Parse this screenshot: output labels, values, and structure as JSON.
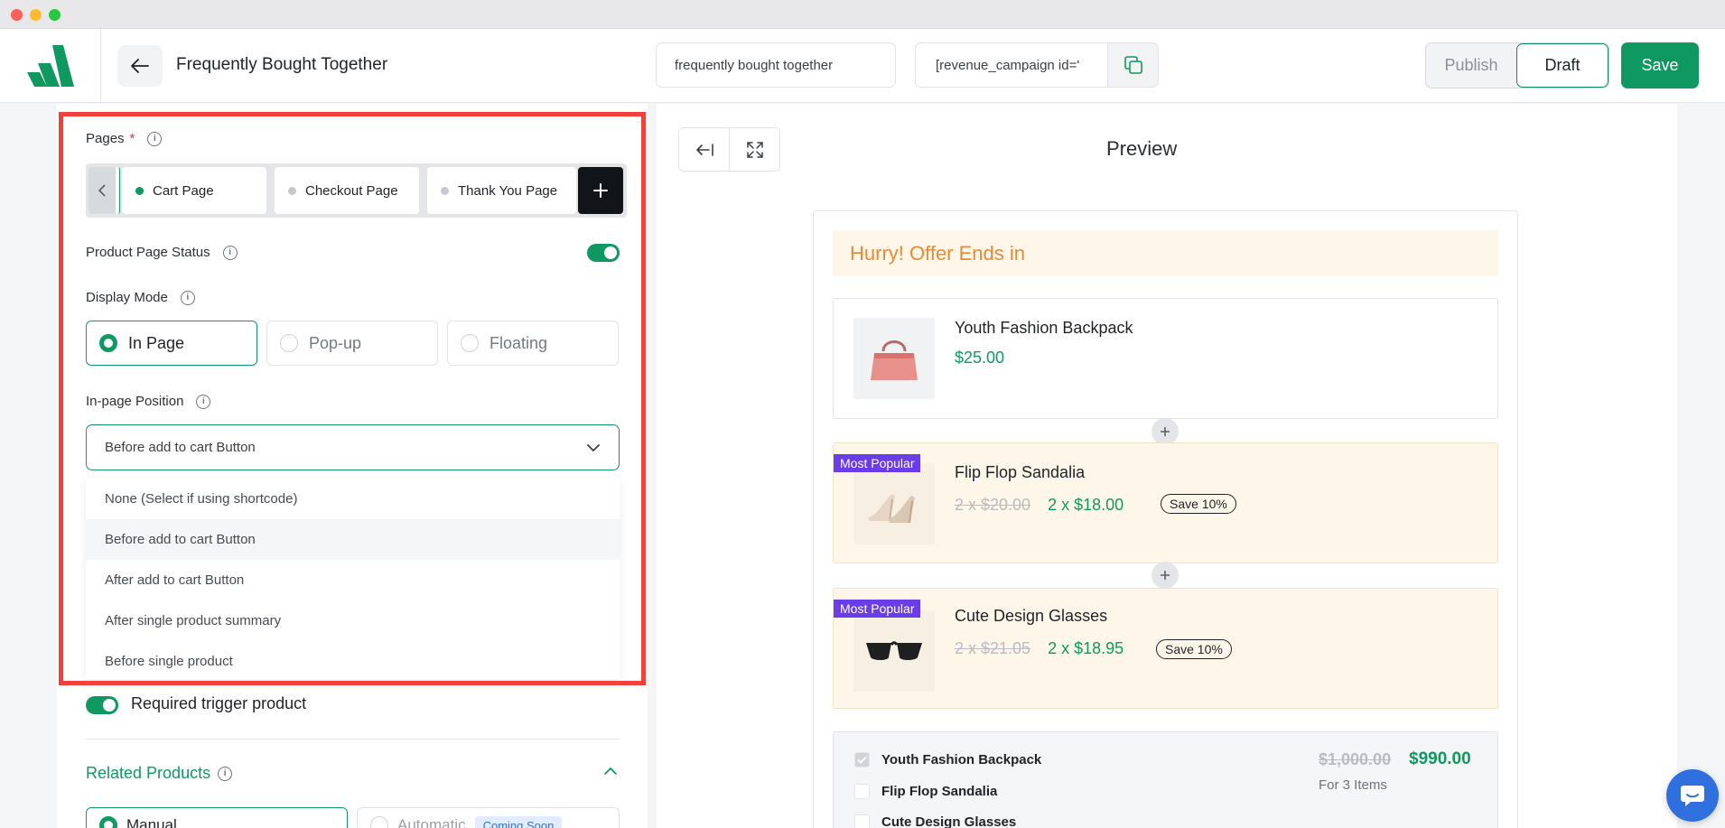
{
  "header": {
    "title": "Frequently Bought Together",
    "campaign_name": "frequently bought together",
    "shortcode": "[revenue_campaign id='",
    "publish_label": "Publish",
    "draft_label": "Draft",
    "save_label": "Save"
  },
  "settings": {
    "pages_label": "Pages",
    "required_mark": "*",
    "pages_tabs": [
      "Cart Page",
      "Checkout Page",
      "Thank You Page"
    ],
    "active_tab": "Cart Page",
    "product_page_status_label": "Product Page Status",
    "product_page_status_on": true,
    "display_mode_label": "Display Mode",
    "display_modes": [
      "In Page",
      "Pop-up",
      "Floating"
    ],
    "selected_display_mode": "In Page",
    "position_label": "In-page Position",
    "position_selected": "Before add to cart Button",
    "position_options": [
      "None (Select if using shortcode)",
      "Before add to cart Button",
      "After add to cart Button",
      "After single product summary",
      "Before single product"
    ],
    "required_trigger_label": "Required trigger product",
    "required_trigger_on": true,
    "related_products_label": "Related Products",
    "related_modes": [
      "Manual",
      "Automatic"
    ],
    "coming_soon": "Coming Soon"
  },
  "preview": {
    "title": "Preview",
    "banner": "Hurry! Offer Ends in",
    "products": [
      {
        "name": "Youth Fashion Backpack",
        "price": "$25.00"
      },
      {
        "name": "Flip Flop Sandalia",
        "badge": "Most Popular",
        "old_price": "2 x $20.00",
        "price": "2 x $18.00",
        "save": "Save 10%"
      },
      {
        "name": "Cute Design Glasses",
        "badge": "Most Popular",
        "old_price": "2 x $21.05",
        "price": "2 x $18.95",
        "save": "Save 10%"
      }
    ],
    "summary": {
      "items": [
        "Youth Fashion Backpack",
        "Flip Flop Sandalia",
        "Cute Design Glasses"
      ],
      "old_total": "$1,000.00",
      "total": "$990.00",
      "for_items": "For 3 Items"
    }
  },
  "colors": {
    "accent": "#0f9960",
    "highlight_border": "#f2413a",
    "badge": "#6a3de8",
    "banner_text": "#e88a35"
  }
}
